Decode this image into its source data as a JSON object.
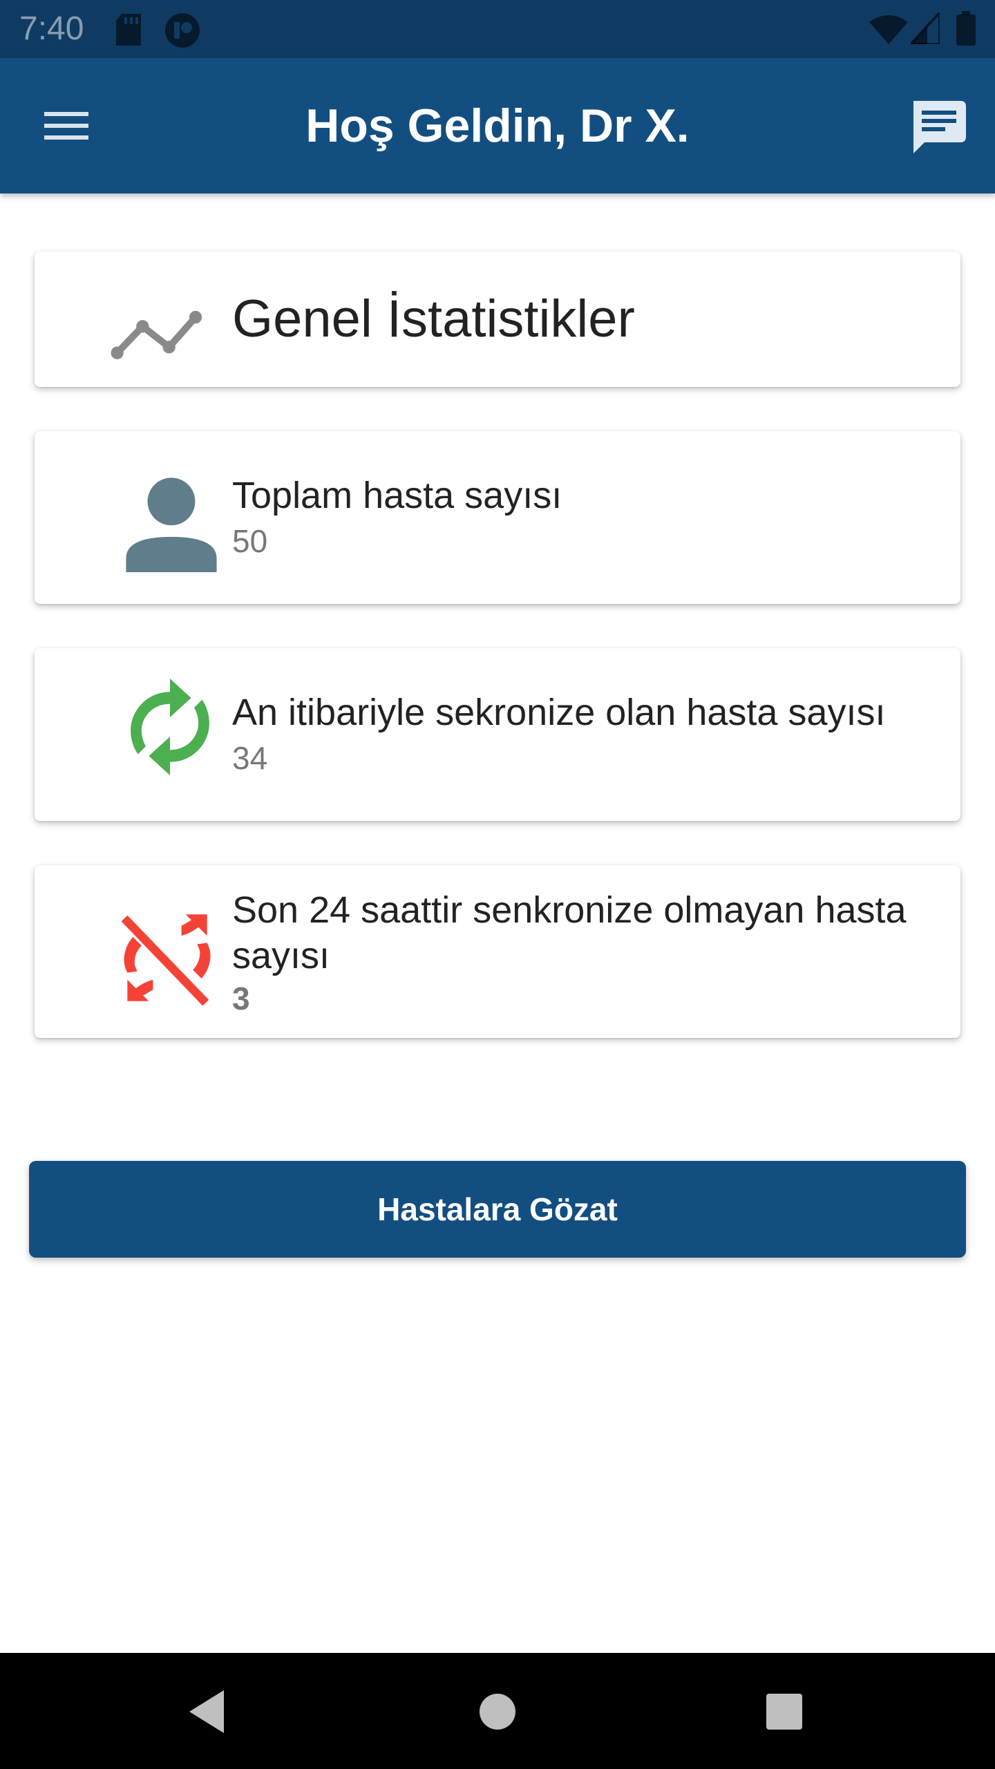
{
  "status_bar": {
    "time": "7:40",
    "icons": [
      "sd-card-icon",
      "app-notification-icon",
      "wifi-icon",
      "signal-icon",
      "battery-icon"
    ]
  },
  "app_bar": {
    "title": "Hoş Geldin, Dr X.",
    "menu_icon": "menu-icon",
    "chat_icon": "message-icon"
  },
  "stats_header": {
    "title": "Genel İstatistikler",
    "icon": "trend-line-icon"
  },
  "stats": [
    {
      "title": "Toplam hasta sayısı",
      "value": "50",
      "icon": "person-icon",
      "icon_color": "#607d8b"
    },
    {
      "title": "An itibariyle sekronize olan hasta sayısı",
      "value": "34",
      "icon": "sync-icon",
      "icon_color": "#4caf50"
    },
    {
      "title": "Son 24 saattir senkronize olmayan hasta sayısı",
      "value": "3",
      "icon": "sync-disabled-icon",
      "icon_color": "#f44336"
    }
  ],
  "browse_button": {
    "label": "Hastalara Gözat"
  },
  "nav_bar": {
    "icons": [
      "back-icon",
      "home-icon",
      "recents-icon"
    ]
  },
  "colors": {
    "primary": "#134e80",
    "status_bar": "#0f3b63"
  }
}
